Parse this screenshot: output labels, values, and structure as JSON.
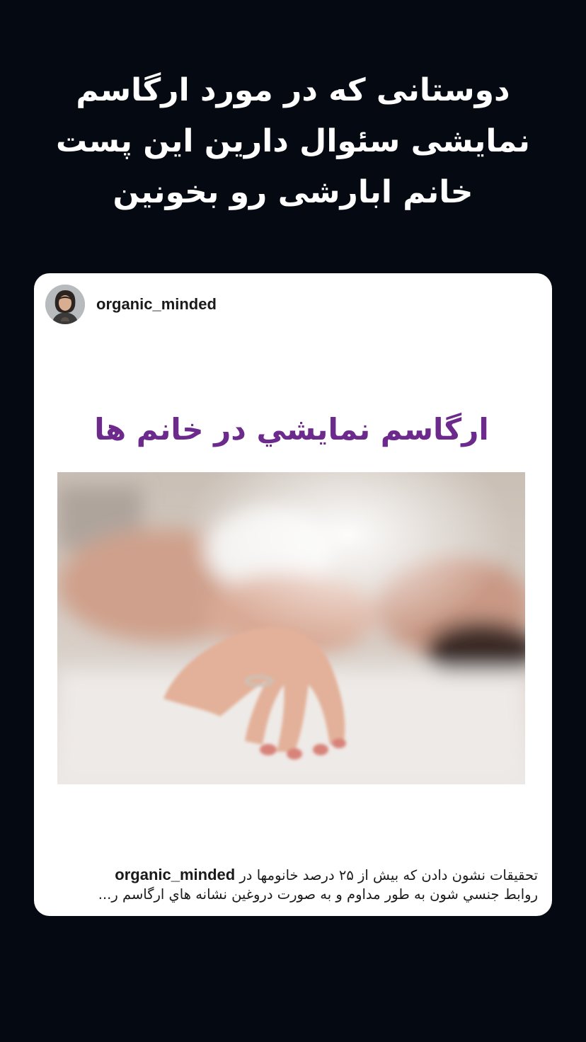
{
  "story": {
    "caption_lines": [
      "دوستانی که در مورد ارگاسم",
      "نمایشی سئوال دارین این پست",
      "خانم ابارشی رو بخونین"
    ]
  },
  "post": {
    "username": "organic_minded",
    "media_title": "ارگاسم نمايشي در خانم ها",
    "caption": {
      "username": "organic_minded",
      "line1_text": "تحقیقات نشون دادن که بیش از ۲۵ درصد خانومها در",
      "line2_text": "روابط جنسي شون به طور مداوم و به صورت دروغين نشانه هاي ارگاسم ر..."
    }
  },
  "colors": {
    "background": "#050911",
    "card": "#ffffff",
    "media_title": "#6b2a8c",
    "story_text": "#ffffff"
  }
}
